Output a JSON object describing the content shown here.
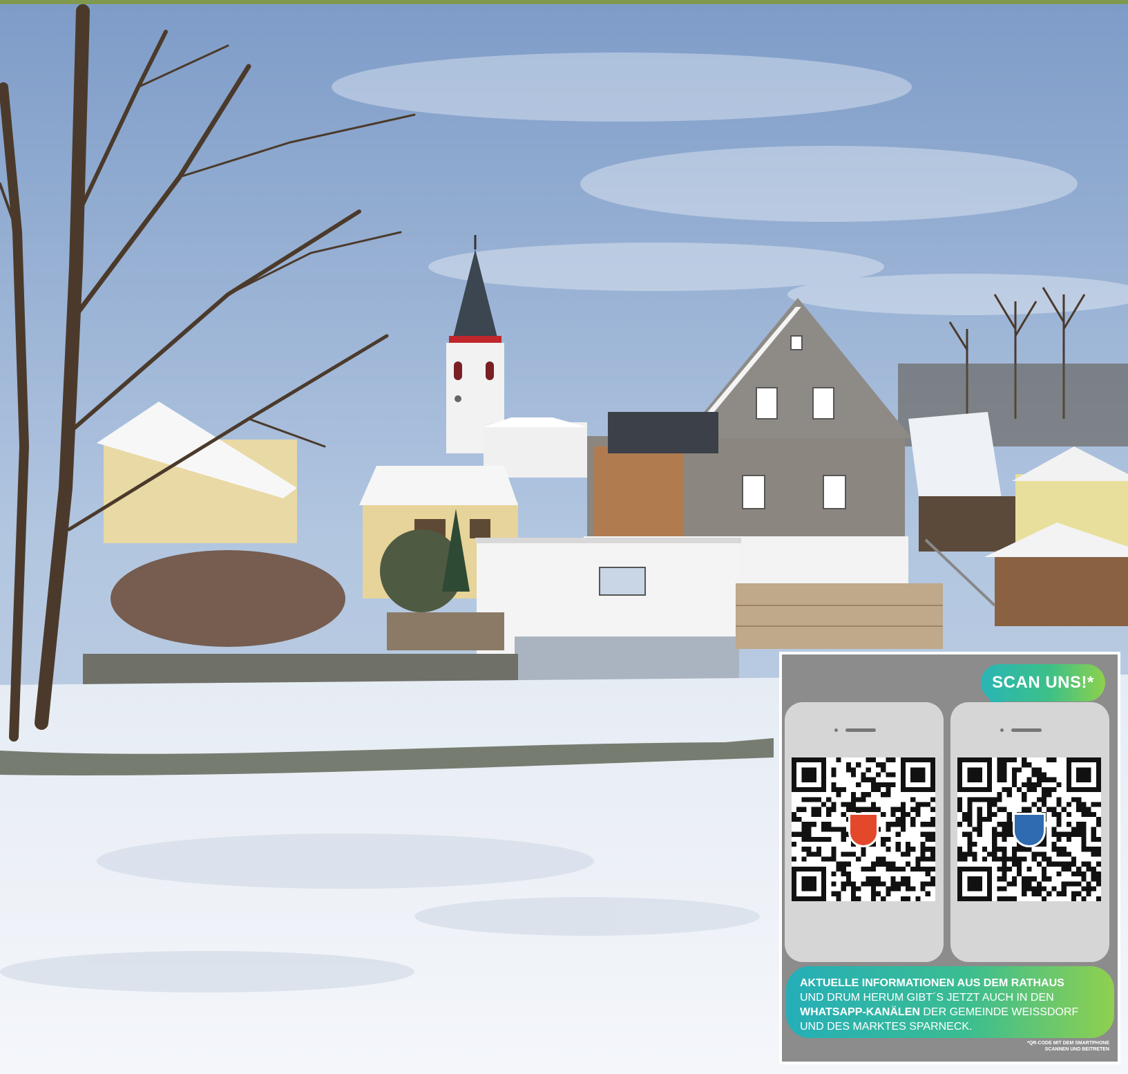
{
  "scene": {
    "subject": "winter-village-with-church"
  },
  "colors": {
    "accent_bar": "#7f9a4e",
    "panel_gray": "#8c8c8c",
    "gradient_start": "#25aeb8",
    "gradient_end": "#8fd04f"
  },
  "qr_panel": {
    "bubble_text": "SCAN UNS!*",
    "info_line1": "AKTUELLE INFORMATIONEN AUS DEM RATHAUS",
    "info_line2": "UND DRUM HERUM GIBT´S JETZT AUCH IN DEN",
    "info_line3_strong": "WHATSAPP-KANÄLEN",
    "info_line3_rest": " DER GEMEINDE WEISSDORF",
    "info_line4": "UND DES MARKTES SPARNECK.",
    "footnote_line1": "*QR-CODE MIT DEM SMARTPHONE",
    "footnote_line2": "SCANNEN UND BEITRETEN",
    "left_emblem": "weissdorf-coat-of-arms-icon",
    "right_emblem": "sparneck-coat-of-arms-icon"
  }
}
